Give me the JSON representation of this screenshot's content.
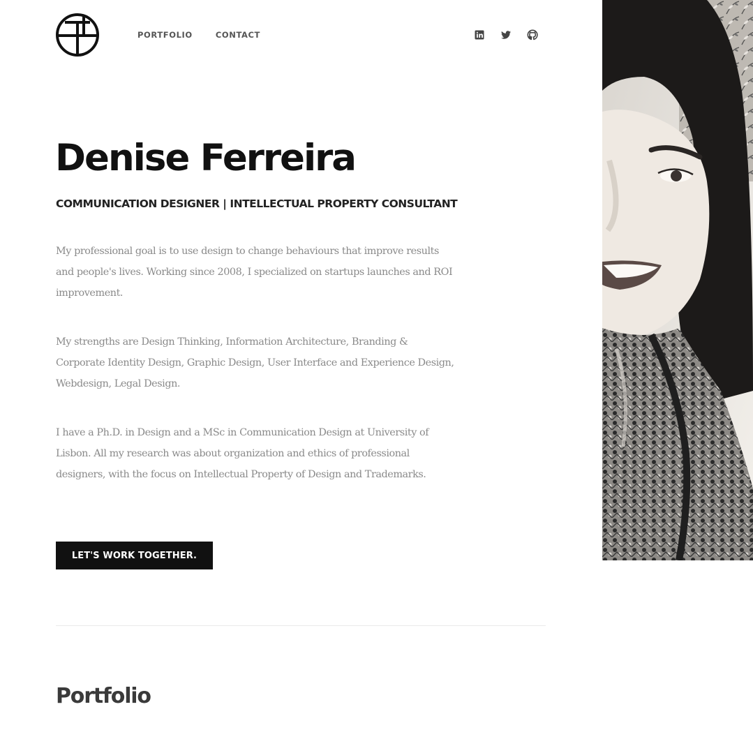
{
  "header": {
    "nav": [
      {
        "label": "PORTFOLIO"
      },
      {
        "label": "CONTACT"
      }
    ],
    "social_icons": [
      "linkedin-icon",
      "twitter-icon",
      "github-icon"
    ]
  },
  "hero": {
    "name": "Denise Ferreira",
    "subtitle": "COMMUNICATION DESIGNER | INTELLECTUAL PROPERTY CONSULTANT",
    "paragraphs": [
      "My professional goal is to use design to change behaviours that improve results and people's lives. Working since 2008, I specialized on startups launches and ROI improvement.",
      "My strengths are Design Thinking, Information Architecture, Branding & Corporate Identity Design, Graphic Design, User Interface and Experience Design, Webdesign, Legal Design.",
      "I have a Ph.D. in Design and a MSc in Communication Design at University of Lisbon. All my research was about organization and ethics of professional designers, with the focus on Intellectual Property of Design and Trademarks."
    ],
    "cta_label": "LET'S WORK TOGETHER."
  },
  "portfolio": {
    "title": "Portfolio"
  },
  "colors": {
    "text": "#111111",
    "body_text": "#8a8a8a",
    "button_bg": "#111111"
  }
}
